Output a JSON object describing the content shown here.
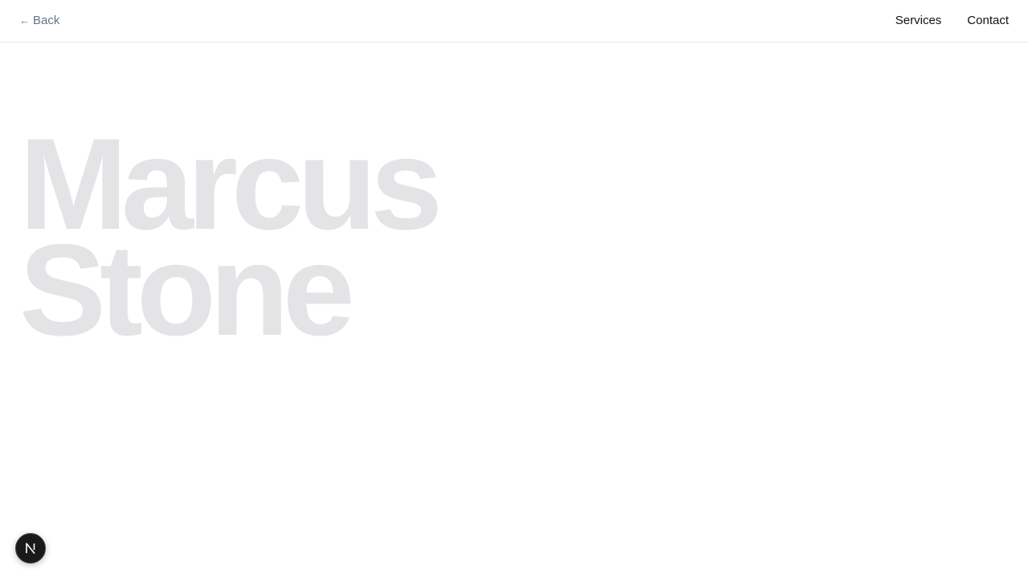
{
  "header": {
    "back_label": "Back",
    "back_icon": "arrow-left-icon",
    "nav": [
      {
        "label": "Services"
      },
      {
        "label": "Contact"
      }
    ]
  },
  "hero": {
    "line1": "Marcus",
    "line2": "Stone",
    "color": "#e4e4e7"
  },
  "badge": {
    "icon": "nextjs-icon",
    "color": "#1a1a1a"
  }
}
